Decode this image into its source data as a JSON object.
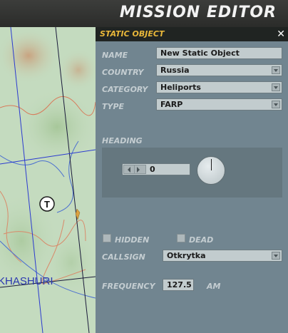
{
  "app": {
    "title": "MISSION EDITOR"
  },
  "map": {
    "town_label": "KHASHURI",
    "marker_label": "T"
  },
  "panel": {
    "title": "STATIC OBJECT",
    "close_glyph": "✕",
    "name": {
      "label": "NAME",
      "value": "New Static Object"
    },
    "country": {
      "label": "COUNTRY",
      "value": "Russia"
    },
    "category": {
      "label": "CATEGORY",
      "value": "Heliports"
    },
    "type": {
      "label": "TYPE",
      "value": "FARP"
    },
    "heading": {
      "label": "HEADING",
      "value": "0"
    },
    "hidden": {
      "label": "HIDDEN",
      "checked": false
    },
    "dead": {
      "label": "DEAD",
      "checked": false
    },
    "callsign": {
      "label": "CALLSIGN",
      "value": "Otkrytka"
    },
    "frequency": {
      "label": "FREQUENCY",
      "value": "127.5",
      "unit": "AM"
    }
  },
  "colors": {
    "accent": "#e8b73a",
    "panel_bg": "#718590",
    "header_bg": "#2b2c2a"
  }
}
